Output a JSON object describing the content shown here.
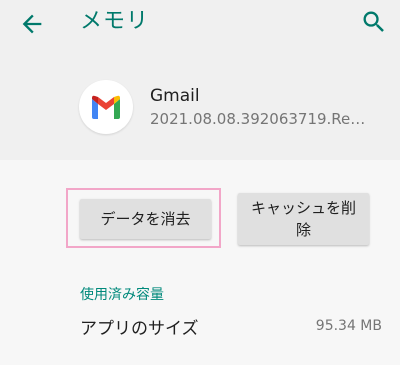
{
  "appbar": {
    "title": "メモリ",
    "back_icon": "arrow-back-icon",
    "search_icon": "search-icon",
    "accent_color": "#00796b"
  },
  "app": {
    "name": "Gmail",
    "version": "2021.08.08.392063719.Relea...",
    "icon": "gmail-logo-icon"
  },
  "actions": {
    "clear_data_label": "データを消去",
    "clear_cache_label": "キャッシュを削除",
    "highlight_color": "#f2a6c8"
  },
  "storage": {
    "section_title": "使用済み容量",
    "rows": [
      {
        "label": "アプリのサイズ",
        "value": "95.34 MB"
      }
    ]
  }
}
